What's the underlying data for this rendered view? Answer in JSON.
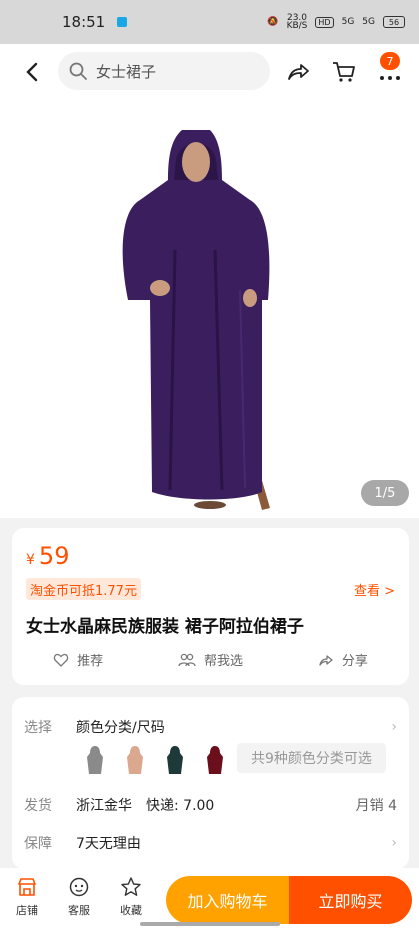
{
  "status": {
    "time": "18:51",
    "speed": "23.0\nKB/S",
    "hd": "HD",
    "net1": "5G",
    "net2": "5G",
    "battery": "56"
  },
  "header": {
    "search_query": "女士裙子",
    "cart_badge": "7"
  },
  "gallery": {
    "counter": "1/5",
    "product_color": "#3b1e5e"
  },
  "product": {
    "currency": "¥",
    "price": "59",
    "coin_deal": "淘金币可抵1.77元",
    "view_label": "查看 >",
    "title": "女士水晶麻民族服装 裙子阿拉伯裙子"
  },
  "actions": [
    {
      "label": "推荐",
      "icon": "heart-icon"
    },
    {
      "label": "帮我选",
      "icon": "people-icon"
    },
    {
      "label": "分享",
      "icon": "share-icon"
    }
  ],
  "options": {
    "select_label": "选择",
    "select_value": "颜色分类/尺码",
    "swatch_colors": [
      "#8a8a8a",
      "#d9a88e",
      "#1d3a38",
      "#6b0f1c"
    ],
    "more_colors": "共9种颜色分类可选",
    "ship_label": "发货",
    "ship_from": "浙江金华",
    "ship_fee": "快递: 7.00",
    "monthly_sales": "月销  4",
    "guarantee_label": "保障",
    "guarantee_value": "7天无理由"
  },
  "bottom": {
    "store": "店铺",
    "service": "客服",
    "favorite": "收藏",
    "add_cart": "加入购物车",
    "buy_now": "立即购买"
  },
  "colors": {
    "accent": "#ff5000",
    "cart_button": "#ffa200"
  }
}
